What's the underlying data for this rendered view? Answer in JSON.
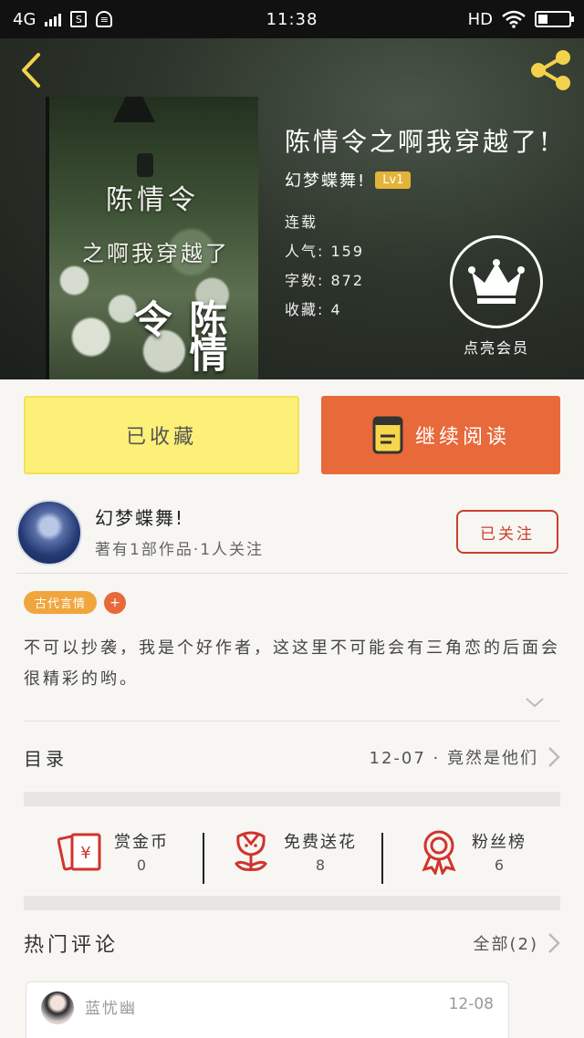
{
  "status_bar": {
    "network": "4G",
    "time": "11:38",
    "hd": "HD"
  },
  "header": {
    "back_icon": "chevron-left-icon",
    "share_icon": "share-icon"
  },
  "cover": {
    "title_line1": "陈情令",
    "title_line2": "之啊我穿越了",
    "seal": "陈情令"
  },
  "book": {
    "title": "陈情令之啊我穿越了!",
    "author": "幻梦蝶舞!",
    "level": "Lv1",
    "status": "连载",
    "popularity": "人气: 159",
    "word_count": "字数: 872",
    "favorites": "收藏: 4",
    "vip_label": "点亮会员"
  },
  "actions": {
    "collected": "已收藏",
    "continue_read": "继续阅读"
  },
  "author_info": {
    "name": "幻梦蝶舞!",
    "sub": "著有1部作品·1人关注",
    "follow": "已关注"
  },
  "tags": [
    "古代言情"
  ],
  "tag_add": "+",
  "description": "不可以抄袭，我是个好作者，这这里不可能会有三角恋的后面会很精彩的哟。",
  "toc": {
    "label": "目录",
    "latest": "12-07 · 竟然是他们"
  },
  "stats": [
    {
      "label": "赏金币",
      "value": "0",
      "icon": "red-envelope-icon"
    },
    {
      "label": "免费送花",
      "value": "8",
      "icon": "flower-icon"
    },
    {
      "label": "粉丝榜",
      "value": "6",
      "icon": "medal-icon"
    }
  ],
  "comments_section": {
    "title": "热门评论",
    "all": "全部(2)"
  },
  "comments": [
    {
      "name": "蓝忧幽",
      "date": "12-08"
    }
  ],
  "colors": {
    "accent_orange": "#e8693a",
    "collected_yellow": "#fcf078",
    "follow_red": "#c9402f",
    "tag_orange": "#f1a53d"
  }
}
